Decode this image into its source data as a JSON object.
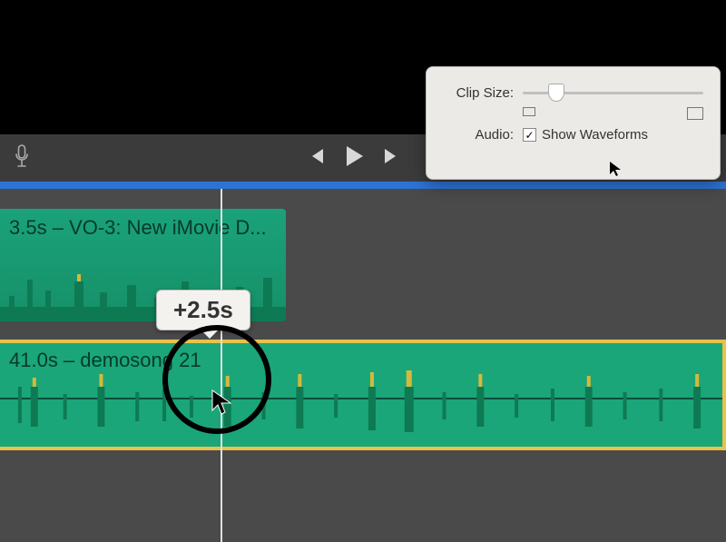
{
  "toolbar": {
    "mic": "mic",
    "prev": "prev",
    "play": "play",
    "next": "next"
  },
  "popover": {
    "clip_size_label": "Clip Size:",
    "audio_label": "Audio:",
    "show_waveforms_label": "Show Waveforms",
    "show_waveforms_checked": true
  },
  "timeline": {
    "clip1": {
      "label": "3.5s – VO-3: New iMovie D..."
    },
    "clip2": {
      "label": "41.0s – demosong 21"
    },
    "tooltip": "+2.5s"
  }
}
